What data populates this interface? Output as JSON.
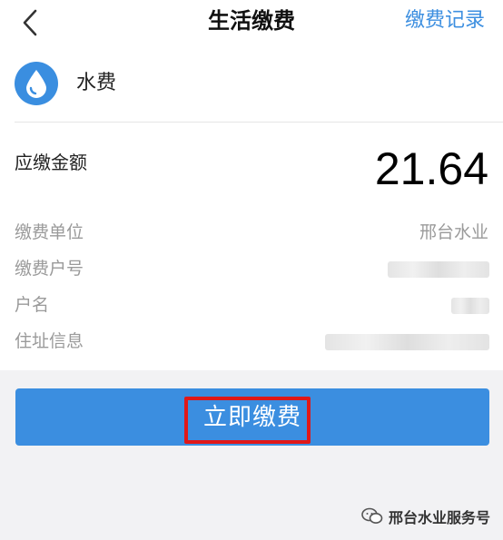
{
  "nav": {
    "back_icon": "chevron-left-icon",
    "title": "生活缴费",
    "records_label": "缴费记录"
  },
  "service": {
    "icon": "water-drop-icon",
    "name": "水费",
    "icon_color": "#3a8ee0"
  },
  "amount": {
    "label": "应缴金额",
    "value": "21.64"
  },
  "info": {
    "unit_label": "缴费单位",
    "unit_value": "邢台水业",
    "account_label": "缴费户号",
    "name_label": "户名",
    "address_label": "住址信息"
  },
  "pay_button": {
    "label": "立即缴费",
    "color": "#3b8ee0",
    "highlight_color": "#e01818"
  },
  "watermark": {
    "icon": "wechat-icon",
    "text": "邢台水业服务号"
  },
  "colors": {
    "accent": "#3d8fe0",
    "background": "#f2f2f4"
  }
}
